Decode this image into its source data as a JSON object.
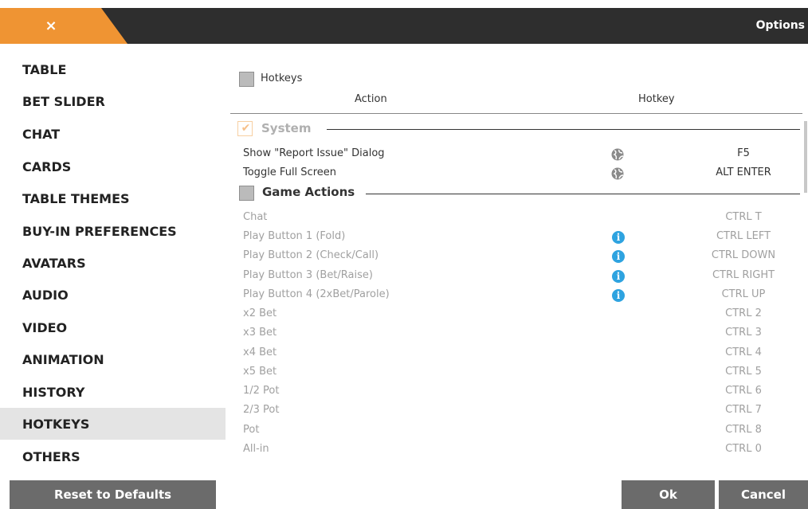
{
  "window": {
    "title": "Options",
    "close_label": "×"
  },
  "sidebar": {
    "items": [
      {
        "label": "TABLE"
      },
      {
        "label": "BET SLIDER"
      },
      {
        "label": "CHAT"
      },
      {
        "label": "CARDS"
      },
      {
        "label": "TABLE THEMES"
      },
      {
        "label": "BUY-IN PREFERENCES"
      },
      {
        "label": "AVATARS"
      },
      {
        "label": "AUDIO"
      },
      {
        "label": "VIDEO"
      },
      {
        "label": "ANIMATION"
      },
      {
        "label": "HISTORY"
      },
      {
        "label": "HOTKEYS",
        "active": true
      },
      {
        "label": "OTHERS"
      }
    ],
    "reset_label": "Reset to Defaults"
  },
  "hotkeys": {
    "enable_label": "Hotkeys",
    "enabled": false,
    "columns": {
      "action": "Action",
      "hotkey": "Hotkey"
    },
    "sections": [
      {
        "title": "System",
        "checked": true,
        "rows": [
          {
            "action": "Show \"Report Issue\" Dialog",
            "key": "F5",
            "icon": "globe-icon"
          },
          {
            "action": "Toggle Full Screen",
            "key": "ALT ENTER",
            "icon": "globe-icon"
          }
        ]
      },
      {
        "title": "Game Actions",
        "checked": false,
        "rows": [
          {
            "action": "Chat",
            "key": "CTRL T"
          },
          {
            "action": "Play Button 1 (Fold)",
            "key": "CTRL LEFT",
            "icon": "info-icon"
          },
          {
            "action": "Play Button 2 (Check/Call)",
            "key": "CTRL DOWN",
            "icon": "info-icon"
          },
          {
            "action": "Play Button 3 (Bet/Raise)",
            "key": "CTRL RIGHT",
            "icon": "info-icon"
          },
          {
            "action": "Play Button 4 (2xBet/Parole)",
            "key": "CTRL UP",
            "icon": "info-icon"
          },
          {
            "action": "x2 Bet",
            "key": "CTRL 2"
          },
          {
            "action": "x3 Bet",
            "key": "CTRL 3"
          },
          {
            "action": "x4 Bet",
            "key": "CTRL 4"
          },
          {
            "action": "x5 Bet",
            "key": "CTRL 5"
          },
          {
            "action": "1/2 Pot",
            "key": "CTRL 6"
          },
          {
            "action": "2/3 Pot",
            "key": "CTRL 7"
          },
          {
            "action": "Pot",
            "key": "CTRL 8"
          },
          {
            "action": "All-in",
            "key": "CTRL 0"
          }
        ]
      }
    ]
  },
  "buttons": {
    "ok": "Ok",
    "cancel": "Cancel"
  },
  "colors": {
    "accent": "#ef9433",
    "titlebar": "#2e2e2e",
    "button": "#6b6b6b",
    "info": "#2ea3e0"
  }
}
